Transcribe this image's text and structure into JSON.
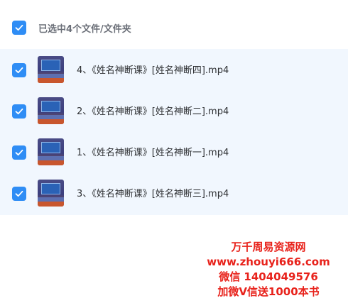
{
  "header": {
    "selection_label": "已选中4个文件/文件夹"
  },
  "files": [
    {
      "name": "4、《姓名神断课》[姓名神断四].mp4"
    },
    {
      "name": "2、《姓名神断课》[姓名神断二].mp4"
    },
    {
      "name": "1、《姓名神断课》[姓名神断一].mp4"
    },
    {
      "name": "3、《姓名神断课》[姓名神断三].mp4"
    }
  ],
  "watermark": {
    "line1": "万千周易资源网",
    "line2": "www.zhouyi666.com",
    "line3": "微信 1404049576",
    "line4": "加微V信送1000本书"
  },
  "colors": {
    "accent": "#2f8df5",
    "list_background": "#f1f7fe",
    "watermark": "#e8221b"
  },
  "icons": {
    "checkbox": "check-icon",
    "thumbnail": "video-thumbnail"
  }
}
